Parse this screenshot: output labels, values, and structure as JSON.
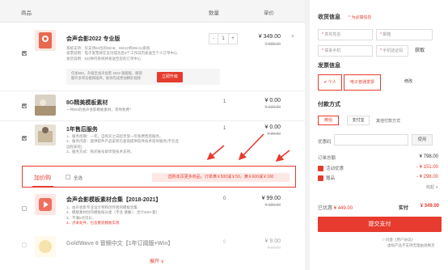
{
  "header": {
    "product": "商品",
    "quantity": "数量",
    "unit_price": "单价"
  },
  "items": [
    {
      "title": "会声会影2022 专业版",
      "desc": [
        "系统支持：仅支持64位的Win8、Win10和Win11系统",
        "发票说明：电子发票将在支付成功后3个工作日内发送至个人订单中心",
        "发货说明：5分钟内系统将发送至您的订单中心"
      ],
      "qty": "1",
      "price": "¥ 349.00",
      "old_price": "¥ 588.00",
      "promo": [
        "仅加¥50，升级至会声会影 2022 旗舰版，解锁",
        "额外多项功能和插件，助你完成更加精彩视频"
      ],
      "upgrade_label": "立即升级"
    },
    {
      "title": "8G精美模板素材",
      "desc": [
        "一共8G的会声会影模板素材，等你免费！"
      ],
      "qty": "1",
      "price": "¥ 0.00",
      "old_price": "¥ 199.00"
    },
    {
      "title": "1年售后服务",
      "desc": [
        "1、服务周期：一年，自购买之日起享受一年免费售后服务。",
        "2、服务内容：提供软件产品安装包查询提供软件技术指导服务(不包含",
        "远程安装)",
        "3、服务方式：购买账号即享受技术支持。"
      ],
      "qty": "1",
      "price": "¥ 0.00",
      "old_price": "¥ 99.00"
    },
    {
      "title": "会声会影模板素材合集【2018-2021】",
      "desc": [
        "1、会声会影专业设计师和创作者的模板合集",
        "2、模版素材创作模板按分类（不含 请确）：合计400+套）",
        "3、不满5点仅价。",
        "4、点本处件，包含重装模板实现"
      ],
      "qty": "0",
      "price": "¥ 99.00",
      "old_price": "¥ 199.00"
    },
    {
      "title": "GoldWave 6 音频中文【1年订阅版+Win】",
      "desc": [],
      "qty": "0",
      "price": "¥ 9.00",
      "old_price": "¥ 99.00"
    }
  ],
  "action_bar": {
    "pay_tab": "加价购",
    "select_all": "全选",
    "promo": "选购本页更多商品，订单满￥500减￥50，满￥600减￥100"
  },
  "expand": "展开 ∨",
  "panel": {
    "receiver_title": "收货信息",
    "receiver_note": "* 为必填信息",
    "fields": {
      "name": "真实姓名",
      "email": "邮箱",
      "phone": "联系手机",
      "code": "手机验证码",
      "get_code": "获取"
    },
    "invoice_title": "发票信息",
    "invoice_options": [
      "个人",
      "电子普通发票",
      "修改"
    ],
    "pay_title": "付款方式",
    "pay_options": [
      "微信",
      "支付宝",
      "其他付款方式"
    ],
    "coupon_label": "优惠码",
    "coupon_button": "使用",
    "order_amount_label": "订单总额",
    "order_amount": "¥ 798.00",
    "activity_label": "活动优惠",
    "activity_amount": "- ¥ 151.00",
    "gift_label": "赠品",
    "gift_amount": "- ¥ 298.00",
    "collapse": "收起 ∧",
    "paid_label": "已优惠",
    "paid_amount": "¥ 449.00",
    "actual_label": "实付",
    "actual_amount": "¥ 349.00",
    "submit": "提交支付",
    "agree": "□ 同意《用户协议》",
    "agree2": "虚拟产品不支持无理由退换货"
  },
  "colors": {
    "accent": "#e63b2e"
  }
}
